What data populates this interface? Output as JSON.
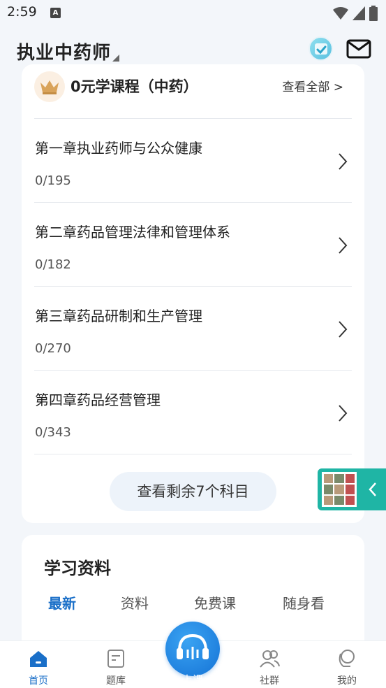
{
  "status_bar": {
    "time": "2:59",
    "notification_icon_letter": "A"
  },
  "header": {
    "title": "执业中药师"
  },
  "course_card": {
    "title": "0元学课程（中药）",
    "see_all": "查看全部 >",
    "items": [
      {
        "name": "第一章执业药师与公众健康",
        "progress": "0/195"
      },
      {
        "name": "第二章药品管理法律和管理体系",
        "progress": "0/182"
      },
      {
        "name": "第三章药品研制和生产管理",
        "progress": "0/270"
      },
      {
        "name": "第四章药品经营管理",
        "progress": "0/343"
      }
    ],
    "more_button": "查看剩余7个科目"
  },
  "materials": {
    "heading": "学习资料",
    "tabs": [
      {
        "label": "最新"
      },
      {
        "label": "资料"
      },
      {
        "label": "免费课"
      },
      {
        "label": "随身看"
      }
    ],
    "active_tab": "最新"
  },
  "bottom_nav": {
    "items": [
      {
        "label": "首页"
      },
      {
        "label": "题库"
      },
      {
        "label": "上课"
      },
      {
        "label": "社群"
      },
      {
        "label": "我的"
      }
    ]
  },
  "colors": {
    "accent": "#1a6fc8",
    "float_widget": "#1fb5a5",
    "page_bg": "#f3f6fa"
  }
}
